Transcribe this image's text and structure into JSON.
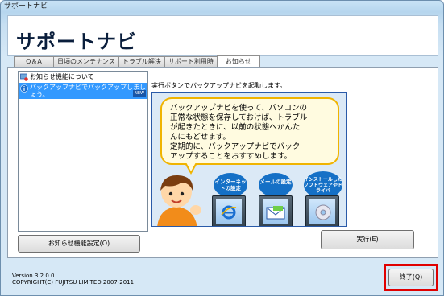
{
  "window": {
    "title": "サポートナビ"
  },
  "header": {
    "app_title": "サポートナビ"
  },
  "tabs": [
    {
      "label": "Q＆A"
    },
    {
      "label": "日頃のメンテナンス"
    },
    {
      "label": "トラブル解決"
    },
    {
      "label": "サポート利用時"
    },
    {
      "label": "お知らせ"
    }
  ],
  "list": {
    "items": [
      {
        "label": "お知らせ機能について"
      },
      {
        "label": "バックアップナビでバックアップしましょう。",
        "badge": "NEW"
      }
    ]
  },
  "buttons": {
    "settings": "お知らせ機能設定(O)",
    "execute": "実行(E)",
    "close": "終了(Q)"
  },
  "detail": {
    "description": "実行ボタンでバックアップナビを起動します。",
    "bubble_lines": [
      "バックアップナビを使って、パソコンの",
      "正常な状態を保存しておけば、トラブル",
      "が起きたときに、以前の状態へかんた",
      "んにもどせます。",
      "定期的に、バックアップナビでバック",
      "アップすることをおすすめします。"
    ],
    "circles": [
      {
        "label": "インターネットの設定"
      },
      {
        "label": "メールの設定"
      },
      {
        "label": "インストールしたソフトウェアやドライバ"
      }
    ]
  },
  "footer": {
    "version": "Version 3.2.0.0",
    "copyright": "COPYRIGHT(C) FUJITSU LIMITED 2007-2011"
  },
  "colors": {
    "selection": "#3399ff",
    "highlight_border": "#e00000",
    "bubble_border": "#f0b400",
    "circle_fill": "#1570c6"
  }
}
